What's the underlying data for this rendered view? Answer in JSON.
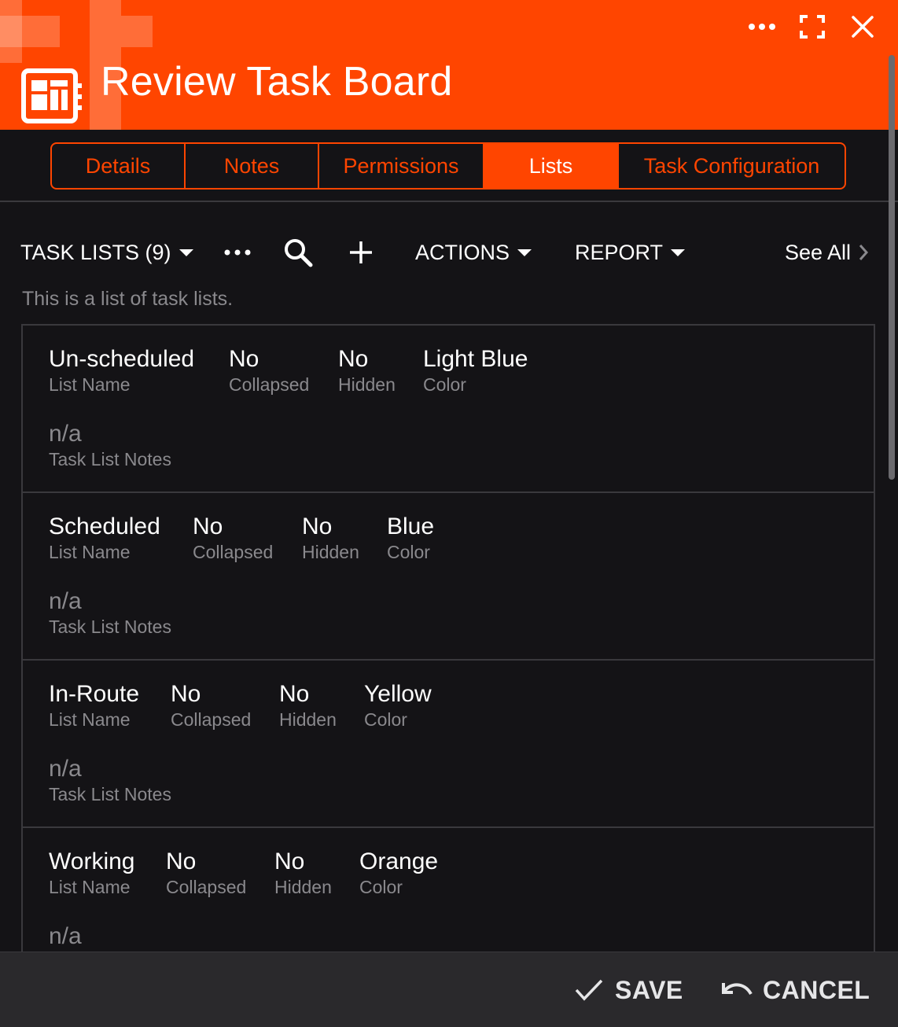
{
  "window": {
    "title": "Review Task Board",
    "icons": [
      "more-icon",
      "fullscreen-icon",
      "close-icon",
      "board-icon"
    ]
  },
  "tabs": [
    {
      "label": "Details",
      "active": false
    },
    {
      "label": "Notes",
      "active": false
    },
    {
      "label": "Permissions",
      "active": false
    },
    {
      "label": "Lists",
      "active": true
    },
    {
      "label": "Task Configuration",
      "active": false
    }
  ],
  "toolbar": {
    "task_lists_label": "TASK LISTS (9)",
    "actions_label": "ACTIONS",
    "report_label": "REPORT",
    "see_all_label": "See All"
  },
  "description": "This is a list of task lists.",
  "labels": {
    "list_name": "List Name",
    "collapsed": "Collapsed",
    "hidden": "Hidden",
    "color": "Color",
    "notes": "Task List Notes"
  },
  "task_lists": [
    {
      "name": "Un-scheduled",
      "collapsed": "No",
      "hidden": "No",
      "color": "Light Blue",
      "notes": "n/a"
    },
    {
      "name": "Scheduled",
      "collapsed": "No",
      "hidden": "No",
      "color": "Blue",
      "notes": "n/a"
    },
    {
      "name": "In-Route",
      "collapsed": "No",
      "hidden": "No",
      "color": "Yellow",
      "notes": "n/a"
    },
    {
      "name": "Working",
      "collapsed": "No",
      "hidden": "No",
      "color": "Orange",
      "notes": "n/a"
    }
  ],
  "footer": {
    "save_label": "SAVE",
    "cancel_label": "CANCEL"
  },
  "colors": {
    "accent": "#ff4500",
    "background": "#141316",
    "muted_text": "#8a898d",
    "footer_bg": "#2a292c"
  }
}
